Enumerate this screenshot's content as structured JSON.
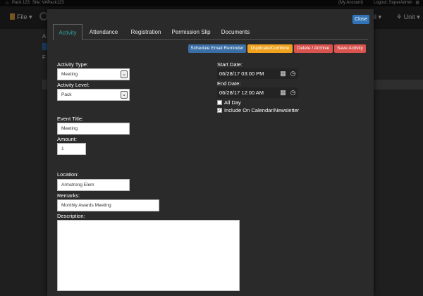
{
  "topbar": {
    "pack": "Pack 123",
    "site": "Site: VAPack123",
    "my_account": "(My Account)",
    "logout": "Logout: SuperAdmin"
  },
  "app": {
    "file_menu": "File",
    "right_menu_partial": "il",
    "unit_menu": "Unit"
  },
  "modal": {
    "close_label": "Close",
    "tabs": [
      {
        "label": "Activity",
        "active": true
      },
      {
        "label": "Attendance",
        "active": false
      },
      {
        "label": "Registration",
        "active": false
      },
      {
        "label": "Permission Slip",
        "active": false
      },
      {
        "label": "Documents",
        "active": false
      }
    ],
    "actions": {
      "schedule_email": {
        "label": "Schedule Email Reminder",
        "color": "#3a6ea5"
      },
      "duplicate": {
        "label": "Duplicate/Combine",
        "color": "#f0a21f"
      },
      "delete": {
        "label": "Delete / Archive",
        "color": "#d9534f"
      },
      "save": {
        "label": "Save Activity",
        "color": "#d9534f"
      }
    },
    "form": {
      "activity_type_label": "Activity Type:",
      "activity_type_value": "Meeting",
      "activity_level_label": "Activity Level:",
      "activity_level_value": "Pack",
      "event_title_label": "Event Title:",
      "event_title_value": "Meeting",
      "amount_label": "Amount:",
      "amount_value": "1",
      "location_label": "Location:",
      "location_value": "Armstrong Elem",
      "remarks_label": "Remarks:",
      "remarks_value": "Monthly Awards Meeting",
      "description_label": "Description:",
      "description_value": "",
      "start_date_label": "Start Date:",
      "start_date_value": "06/28/17 03:00 PM",
      "end_date_label": "End Date:",
      "end_date_value": "06/28/17 12:00 AM",
      "all_day_label": "All Day",
      "all_day_checked": false,
      "include_calendar_label": "Include On Calendar/Newsletter",
      "include_calendar_checked": true
    }
  },
  "colors": {
    "accent_tab": "#2fa4a0",
    "close_button": "#3273b7"
  }
}
